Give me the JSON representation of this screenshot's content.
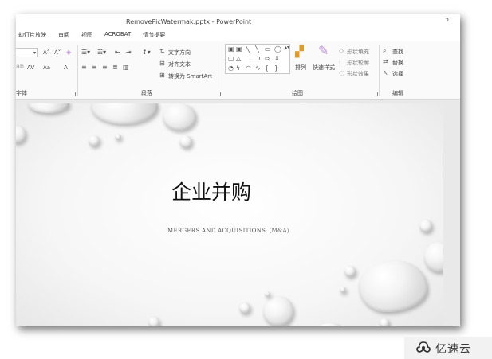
{
  "window": {
    "title": "RemovePicWatermak.pptx - PowerPoint",
    "help": "?"
  },
  "tabs": [
    "幻灯片放映",
    "审阅",
    "视图",
    "ACROBAT",
    "情节提要"
  ],
  "ribbon": {
    "font_group": {
      "label": "字体",
      "grow": "A˄",
      "shrink": "A˅",
      "clear": "A",
      "case": "Aa",
      "av": "AV"
    },
    "paragraph_group": {
      "label": "段落",
      "text_direction": "文字方向",
      "align_text": "对齐文本",
      "convert_smartart": "转换为 SmartArt"
    },
    "drawing_group": {
      "label": "绘图",
      "arrange": "排列",
      "quick_styles": "快速样式",
      "shape_fill": "形状填充",
      "shape_outline": "形状轮廓",
      "shape_effects": "形状效果"
    },
    "editing_group": {
      "label": "编辑",
      "find": "查找",
      "replace": "替换",
      "select": "选择"
    }
  },
  "slide": {
    "title": "企业并购",
    "subtitle": "MERGERS AND ACQUISITIONS（M&A）"
  },
  "watermark": {
    "text": "亿速云"
  }
}
